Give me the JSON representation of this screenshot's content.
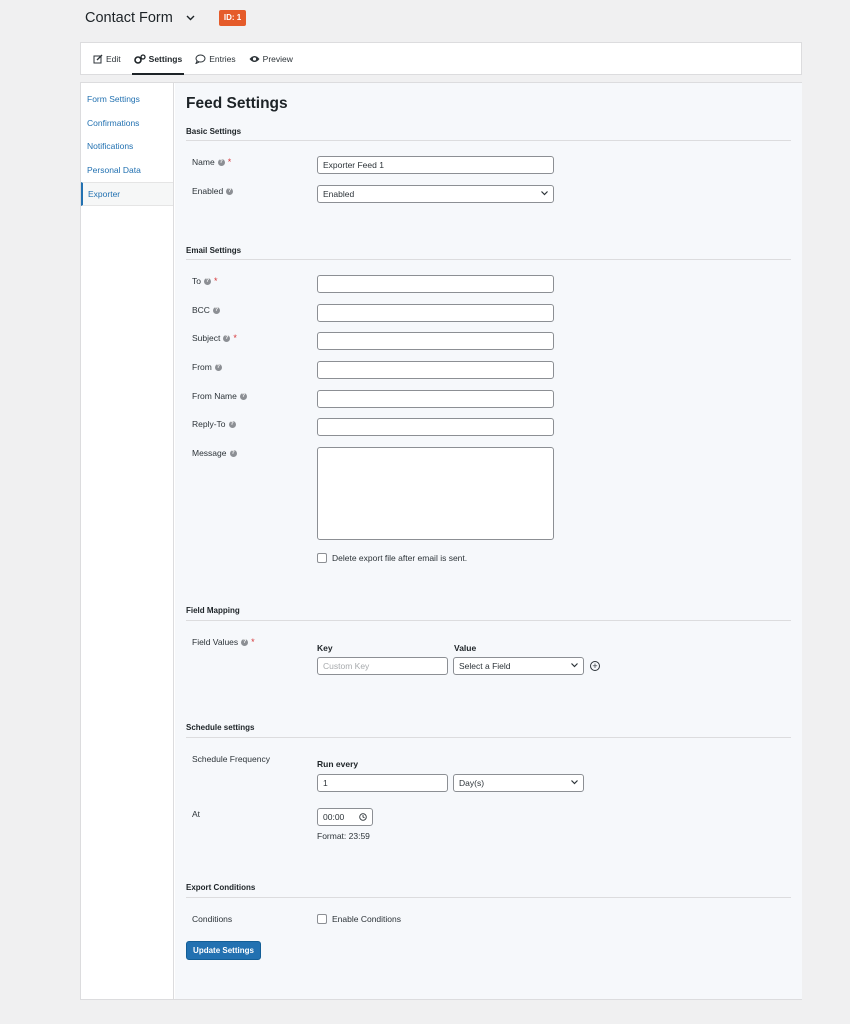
{
  "header": {
    "title": "Contact Form",
    "id_badge": "ID: 1"
  },
  "tabs": [
    {
      "label": "Edit",
      "icon": "edit-icon"
    },
    {
      "label": "Settings",
      "icon": "gears-icon",
      "active": true
    },
    {
      "label": "Entries",
      "icon": "chat-bubble-icon"
    },
    {
      "label": "Preview",
      "icon": "eye-icon"
    }
  ],
  "sidebar": {
    "items": [
      {
        "label": "Form Settings"
      },
      {
        "label": "Confirmations"
      },
      {
        "label": "Notifications"
      },
      {
        "label": "Personal Data"
      },
      {
        "label": "Exporter",
        "active": true
      }
    ]
  },
  "page": {
    "title": "Feed Settings"
  },
  "basic": {
    "heading": "Basic Settings",
    "name_label": "Name",
    "name_value": "Exporter Feed 1",
    "enabled_label": "Enabled",
    "enabled_value": "Enabled"
  },
  "email": {
    "heading": "Email Settings",
    "to_label": "To",
    "bcc_label": "BCC",
    "subject_label": "Subject",
    "from_label": "From",
    "from_name_label": "From Name",
    "reply_to_label": "Reply-To",
    "message_label": "Message",
    "delete_checkbox_label": "Delete export file after email is sent."
  },
  "mapping": {
    "heading": "Field Mapping",
    "field_values_label": "Field Values",
    "key_header": "Key",
    "value_header": "Value",
    "key_placeholder": "Custom Key",
    "value_select": "Select a Field"
  },
  "schedule": {
    "heading": "Schedule settings",
    "frequency_label": "Schedule Frequency",
    "run_every_label": "Run every",
    "run_every_value": "1",
    "unit_value": "Day(s)",
    "at_label": "At",
    "time_value": "00:00",
    "format_note": "Format: 23:59"
  },
  "conditions": {
    "heading": "Export Conditions",
    "conditions_label": "Conditions",
    "enable_label": "Enable Conditions"
  },
  "actions": {
    "update_label": "Update Settings"
  },
  "colors": {
    "accent": "#2271b1",
    "badge": "#e55b2a",
    "required": "#d63638"
  }
}
